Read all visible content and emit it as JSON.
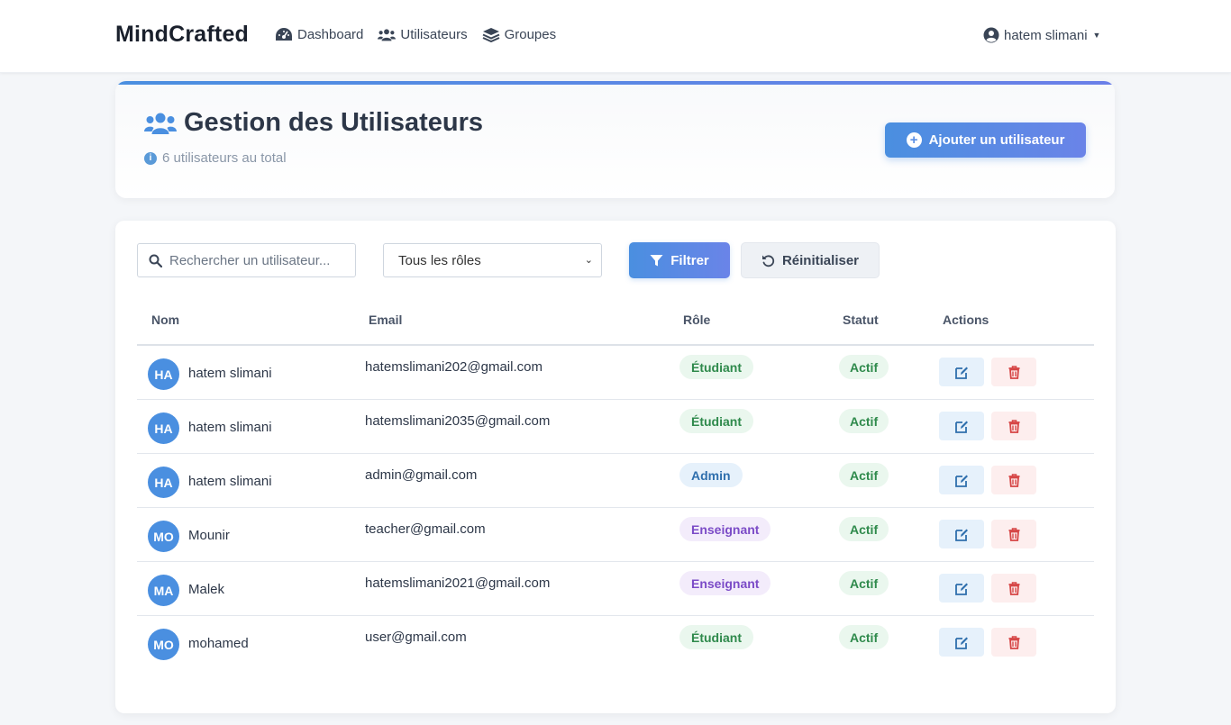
{
  "navbar": {
    "brand": "MindCrafted",
    "links": [
      {
        "label": "Dashboard",
        "icon": "tachometer-icon"
      },
      {
        "label": "Utilisateurs",
        "icon": "users-icon"
      },
      {
        "label": "Groupes",
        "icon": "layers-icon"
      }
    ],
    "user": {
      "name": "hatem slimani",
      "icon": "user-circle-icon"
    }
  },
  "header": {
    "title": "Gestion des Utilisateurs",
    "subtitle": "6 utilisateurs au total",
    "add_button": "Ajouter un utilisateur"
  },
  "filters": {
    "search_placeholder": "Rechercher un utilisateur...",
    "role_selected": "Tous les rôles",
    "filter_button": "Filtrer",
    "reset_button": "Réinitialiser"
  },
  "table": {
    "columns": [
      "Nom",
      "Email",
      "Rôle",
      "Statut",
      "Actions"
    ],
    "rows": [
      {
        "initials": "HA",
        "name": "hatem slimani",
        "email": "hatemslimani202@gmail.com",
        "role": "Étudiant",
        "status": "Actif"
      },
      {
        "initials": "HA",
        "name": "hatem slimani",
        "email": "hatemslimani2035@gmail.com",
        "role": "Étudiant",
        "status": "Actif"
      },
      {
        "initials": "HA",
        "name": "hatem slimani",
        "email": "admin@gmail.com",
        "role": "Admin",
        "status": "Actif"
      },
      {
        "initials": "MO",
        "name": "Mounir",
        "email": "teacher@gmail.com",
        "role": "Enseignant",
        "status": "Actif"
      },
      {
        "initials": "MA",
        "name": "Malek",
        "email": "hatemslimani2021@gmail.com",
        "role": "Enseignant",
        "status": "Actif"
      },
      {
        "initials": "MO",
        "name": "mohamed",
        "email": "user@gmail.com",
        "role": "Étudiant",
        "status": "Actif"
      }
    ]
  },
  "colors": {
    "accent": "#4a8fe0",
    "success": "#2f8a4c",
    "danger": "#d64545",
    "purple": "#7b4bc7"
  }
}
